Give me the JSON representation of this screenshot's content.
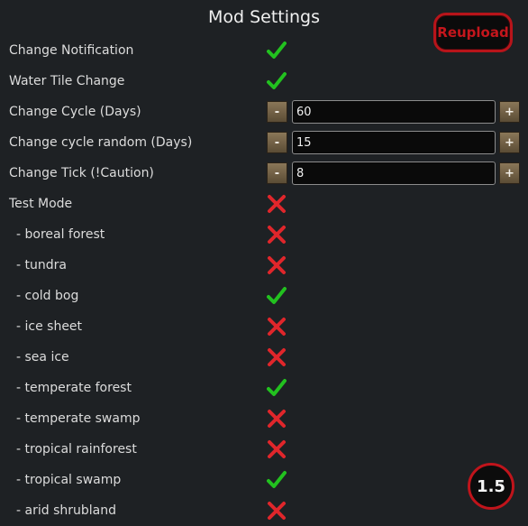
{
  "title": "Mod Settings",
  "reupload_label": "Reupload",
  "version_badge": "1.5",
  "colors": {
    "check": "#22c11f",
    "cross": "#e0262b",
    "accent": "#c0141b"
  },
  "icons": {
    "checked": "check-icon",
    "unchecked": "cross-icon",
    "decrease": "minus",
    "increase": "plus"
  },
  "stepper_buttons": {
    "minus": "-",
    "plus": "+"
  },
  "settings": [
    {
      "label": "Change Notification",
      "type": "toggle",
      "value": true
    },
    {
      "label": "Water Tile Change",
      "type": "toggle",
      "value": true
    },
    {
      "label": "Change Cycle (Days)",
      "type": "number",
      "value": "60"
    },
    {
      "label": "Change cycle random (Days)",
      "type": "number",
      "value": "15"
    },
    {
      "label": "Change Tick (!Caution)",
      "type": "number",
      "value": "8"
    },
    {
      "label": "Test Mode",
      "type": "toggle",
      "value": false
    },
    {
      "label": "- boreal forest",
      "type": "toggle",
      "value": false,
      "indent": true
    },
    {
      "label": "- tundra",
      "type": "toggle",
      "value": false,
      "indent": true
    },
    {
      "label": "- cold bog",
      "type": "toggle",
      "value": true,
      "indent": true
    },
    {
      "label": "- ice sheet",
      "type": "toggle",
      "value": false,
      "indent": true
    },
    {
      "label": "- sea ice",
      "type": "toggle",
      "value": false,
      "indent": true
    },
    {
      "label": "- temperate forest",
      "type": "toggle",
      "value": true,
      "indent": true
    },
    {
      "label": "- temperate swamp",
      "type": "toggle",
      "value": false,
      "indent": true
    },
    {
      "label": "- tropical rainforest",
      "type": "toggle",
      "value": false,
      "indent": true
    },
    {
      "label": "- tropical swamp",
      "type": "toggle",
      "value": true,
      "indent": true
    },
    {
      "label": "- arid shrubland",
      "type": "toggle",
      "value": false,
      "indent": true
    }
  ]
}
